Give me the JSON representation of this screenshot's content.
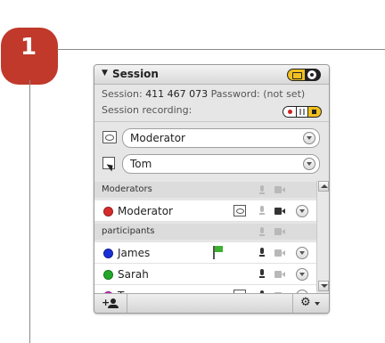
{
  "step": {
    "number": "1"
  },
  "panel": {
    "title": "Session",
    "session_label": "Session:",
    "session_id": "411 467 073",
    "password_label": "Password:",
    "password_value": "(not set)",
    "recording_label": "Session recording:",
    "role_select": "Moderator",
    "user_select": "Tom",
    "sections": [
      {
        "label": "Moderators"
      },
      {
        "label": "participants"
      }
    ],
    "moderators": [
      {
        "name": "Moderator",
        "color": "#d62b2b"
      }
    ],
    "participants": [
      {
        "name": "James",
        "color": "#1a2fd6",
        "flag_color": "#3db030"
      },
      {
        "name": "Sarah",
        "color": "#22a829"
      },
      {
        "name": "Tom",
        "color": "#cc22cc"
      }
    ],
    "add_user_label": "+",
    "accent": "#f0c020"
  }
}
